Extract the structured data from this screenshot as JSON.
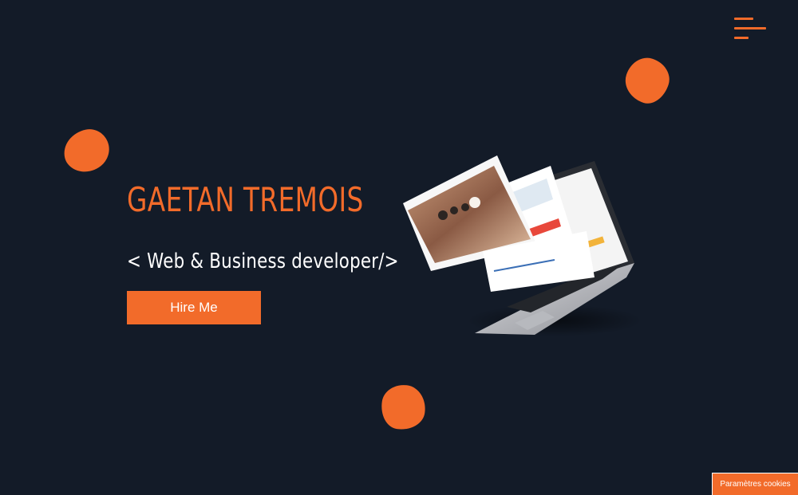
{
  "header": {
    "menu_icon": "hamburger-menu-icon"
  },
  "hero": {
    "name": "GAETAN TREMOIS",
    "subtitle": "< Web & Business developer/>",
    "cta_label": "Hire Me"
  },
  "illustration": {
    "description_icon": "laptop-portfolio-illustration"
  },
  "footer": {
    "cookie_button_label": "Paramètres cookies"
  },
  "colors": {
    "background": "#131b28",
    "accent": "#f26b2a",
    "text": "#ffffff"
  }
}
